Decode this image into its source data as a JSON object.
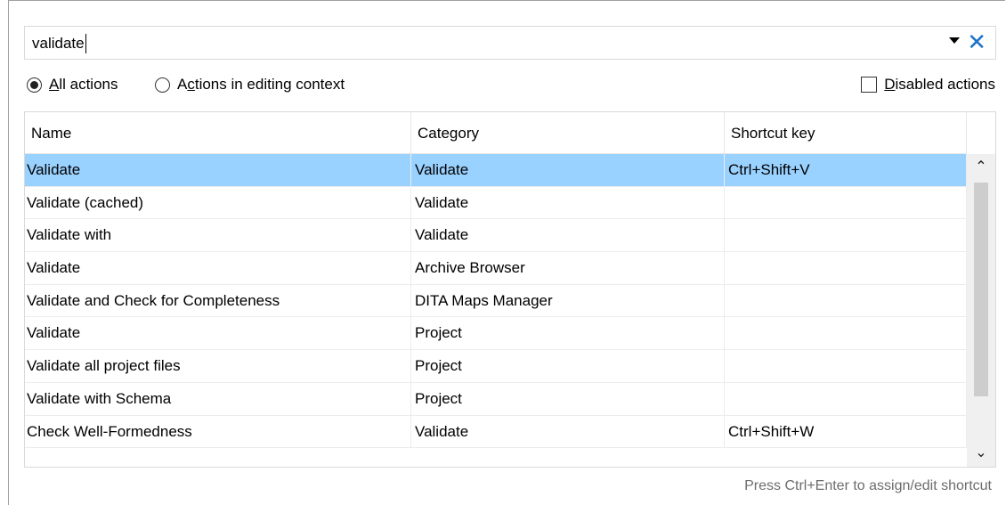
{
  "search": {
    "value": "validate"
  },
  "options": {
    "all_actions": "All actions",
    "editing_context": "Actions in editing context",
    "disabled_actions": "Disabled actions"
  },
  "table": {
    "headers": [
      "Name",
      "Category",
      "Shortcut key"
    ],
    "rows": [
      [
        "Validate",
        "Validate",
        "Ctrl+Shift+V"
      ],
      [
        "Validate (cached)",
        "Validate",
        ""
      ],
      [
        "Validate with",
        "Validate",
        ""
      ],
      [
        "Validate",
        "Archive Browser",
        ""
      ],
      [
        "Validate and Check for Completeness",
        "DITA Maps Manager",
        ""
      ],
      [
        "Validate",
        "Project",
        ""
      ],
      [
        "Validate all project files",
        "Project",
        ""
      ],
      [
        "Validate with Schema",
        "Project",
        ""
      ],
      [
        "Check Well-Formedness",
        "Validate",
        "Ctrl+Shift+W"
      ]
    ]
  },
  "hint": "Press Ctrl+Enter to assign/edit shortcut",
  "icons": {
    "dropdown": "dropdown-arrow-icon",
    "clear": "clear-icon",
    "scroll_up": "chevron-up-icon",
    "scroll_down": "chevron-down-icon"
  },
  "colors": {
    "selection": "#99d1ff",
    "clear_icon": "#1e73c8"
  }
}
